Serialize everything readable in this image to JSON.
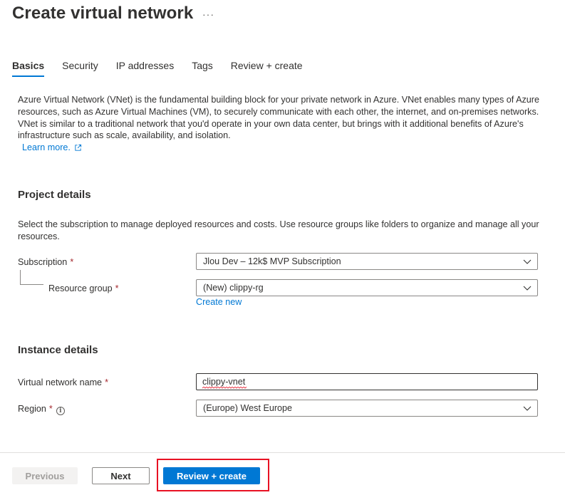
{
  "header": {
    "title": "Create virtual network",
    "more_label": "···"
  },
  "tabs": [
    {
      "label": "Basics",
      "active": true
    },
    {
      "label": "Security",
      "active": false
    },
    {
      "label": "IP addresses",
      "active": false
    },
    {
      "label": "Tags",
      "active": false
    },
    {
      "label": "Review + create",
      "active": false
    }
  ],
  "intro": {
    "text": "Azure Virtual Network (VNet) is the fundamental building block for your private network in Azure. VNet enables many types of Azure resources, such as Azure Virtual Machines (VM), to securely communicate with each other, the internet, and on-premises networks. VNet is similar to a traditional network that you'd operate in your own data center, but brings with it additional benefits of Azure's infrastructure such as scale, availability, and isolation.",
    "learn_more": "Learn more.",
    "learn_more_icon": "external-link-icon"
  },
  "project_details": {
    "title": "Project details",
    "description": "Select the subscription to manage deployed resources and costs. Use resource groups like folders to organize and manage all your resources.",
    "subscription_label": "Subscription",
    "subscription_value": "Jlou Dev – 12k$ MVP Subscription",
    "resource_group_label": "Resource group",
    "resource_group_value": "(New) clippy-rg",
    "create_new": "Create new"
  },
  "instance_details": {
    "title": "Instance details",
    "vnet_name_label": "Virtual network name",
    "vnet_name_value": "clippy-vnet",
    "region_label": "Region",
    "region_value": "(Europe) West Europe",
    "info_icon": "info-icon"
  },
  "required_marker": "*",
  "footer": {
    "previous": "Previous",
    "next": "Next",
    "review_create": "Review + create"
  },
  "colors": {
    "accent": "#0078d4",
    "required": "#a4262c",
    "highlight": "#e81123"
  }
}
